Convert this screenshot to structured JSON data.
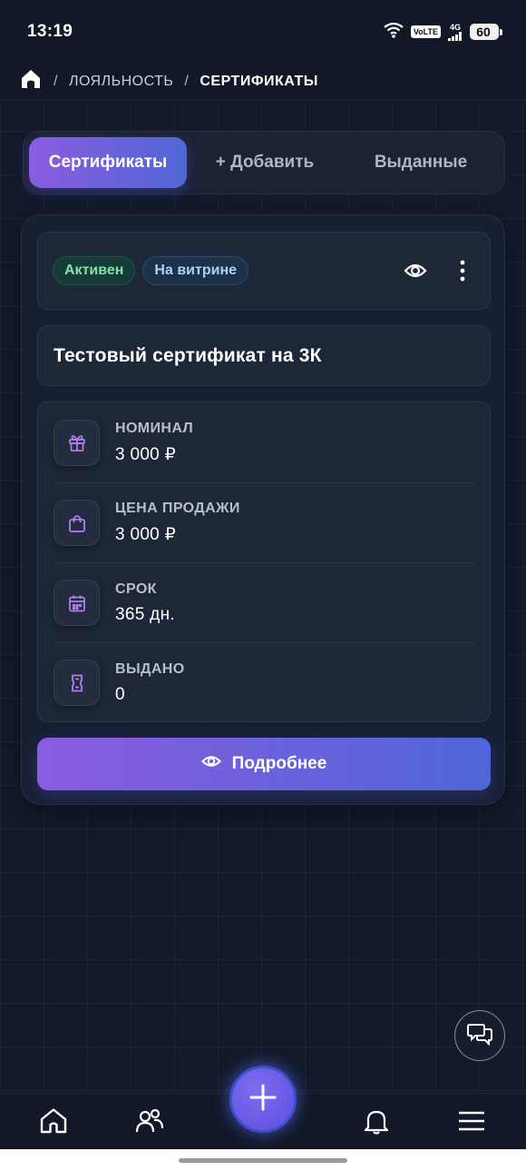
{
  "status_bar": {
    "time": "13:19",
    "volte": "VoLTE",
    "network": "4G",
    "battery": "60"
  },
  "breadcrumb": {
    "items": [
      "ЛОЯЛЬНОСТЬ",
      "СЕРТИФИКАТЫ"
    ],
    "separator": "/"
  },
  "tabs": [
    {
      "label": "Сертификаты",
      "active": true
    },
    {
      "label": "+ Добавить",
      "active": false
    },
    {
      "label": "Выданные",
      "active": false
    }
  ],
  "certificate": {
    "badges": [
      {
        "label": "Активен",
        "color": "#7fe3b0"
      },
      {
        "label": "На витрине",
        "color": "#a9d2f5"
      }
    ],
    "title": "Тестовый сертификат на 3К",
    "info": [
      {
        "icon": "gift-icon",
        "label": "НОМИНАЛ",
        "value": "3 000 ₽"
      },
      {
        "icon": "shopping-bag-icon",
        "label": "ЦЕНА ПРОДАЖИ",
        "value": "3 000 ₽"
      },
      {
        "icon": "calendar-icon",
        "label": "СРОК",
        "value": "365 дн."
      },
      {
        "icon": "ticket-icon",
        "label": "ВЫДАНО",
        "value": "0"
      }
    ],
    "details_button": "Подробнее"
  },
  "colors": {
    "accent_start": "#8b5ce0",
    "accent_end": "#5067d6",
    "icon_purple": "#b07cf0",
    "background": "#131a2b"
  }
}
